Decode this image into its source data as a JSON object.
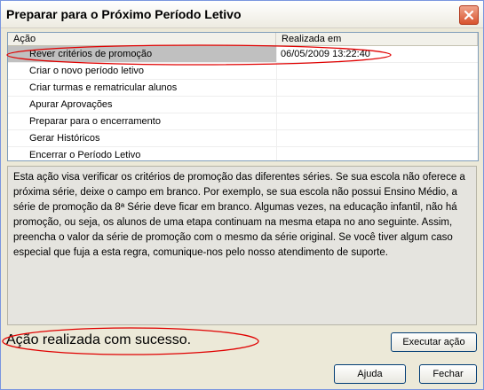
{
  "window": {
    "title": "Preparar para o Próximo Período Letivo",
    "close_icon": "close-icon"
  },
  "list": {
    "columns": [
      "Ação",
      "Realizada em"
    ],
    "rows": [
      {
        "action": "Rever critérios de promoção",
        "done_at": "06/05/2009 13:22:40",
        "selected": true
      },
      {
        "action": "Criar o novo período letivo",
        "done_at": ""
      },
      {
        "action": "Criar turmas e rematricular alunos",
        "done_at": ""
      },
      {
        "action": "Apurar Aprovações",
        "done_at": ""
      },
      {
        "action": "Preparar para o encerramento",
        "done_at": ""
      },
      {
        "action": "Gerar Históricos",
        "done_at": ""
      },
      {
        "action": "Encerrar o Período Letivo",
        "done_at": ""
      }
    ]
  },
  "description": "Esta ação visa verificar os critérios de promoção das diferentes séries. Se sua escola não oferece a próxima série, deixe o campo em branco. Por exemplo, se sua escola não possui Ensino Médio, a série de promoção da 8ª Série deve ficar em branco. Algumas vezes, na educação infantil, não há promoção, ou seja, os alunos de uma etapa continuam na mesma etapa no ano seguinte. Assim, preencha o valor da série de promoção com o mesmo da série original. Se você tiver algum caso especial que fuja a esta regra, comunique-nos pelo nosso atendimento de suporte.",
  "status_text": "Ação realizada com sucesso.",
  "buttons": {
    "execute": "Executar ação",
    "help": "Ajuda",
    "close": "Fechar"
  },
  "colors": {
    "annotation_red": "#E00000",
    "selection_gray": "#C0C0C0"
  }
}
